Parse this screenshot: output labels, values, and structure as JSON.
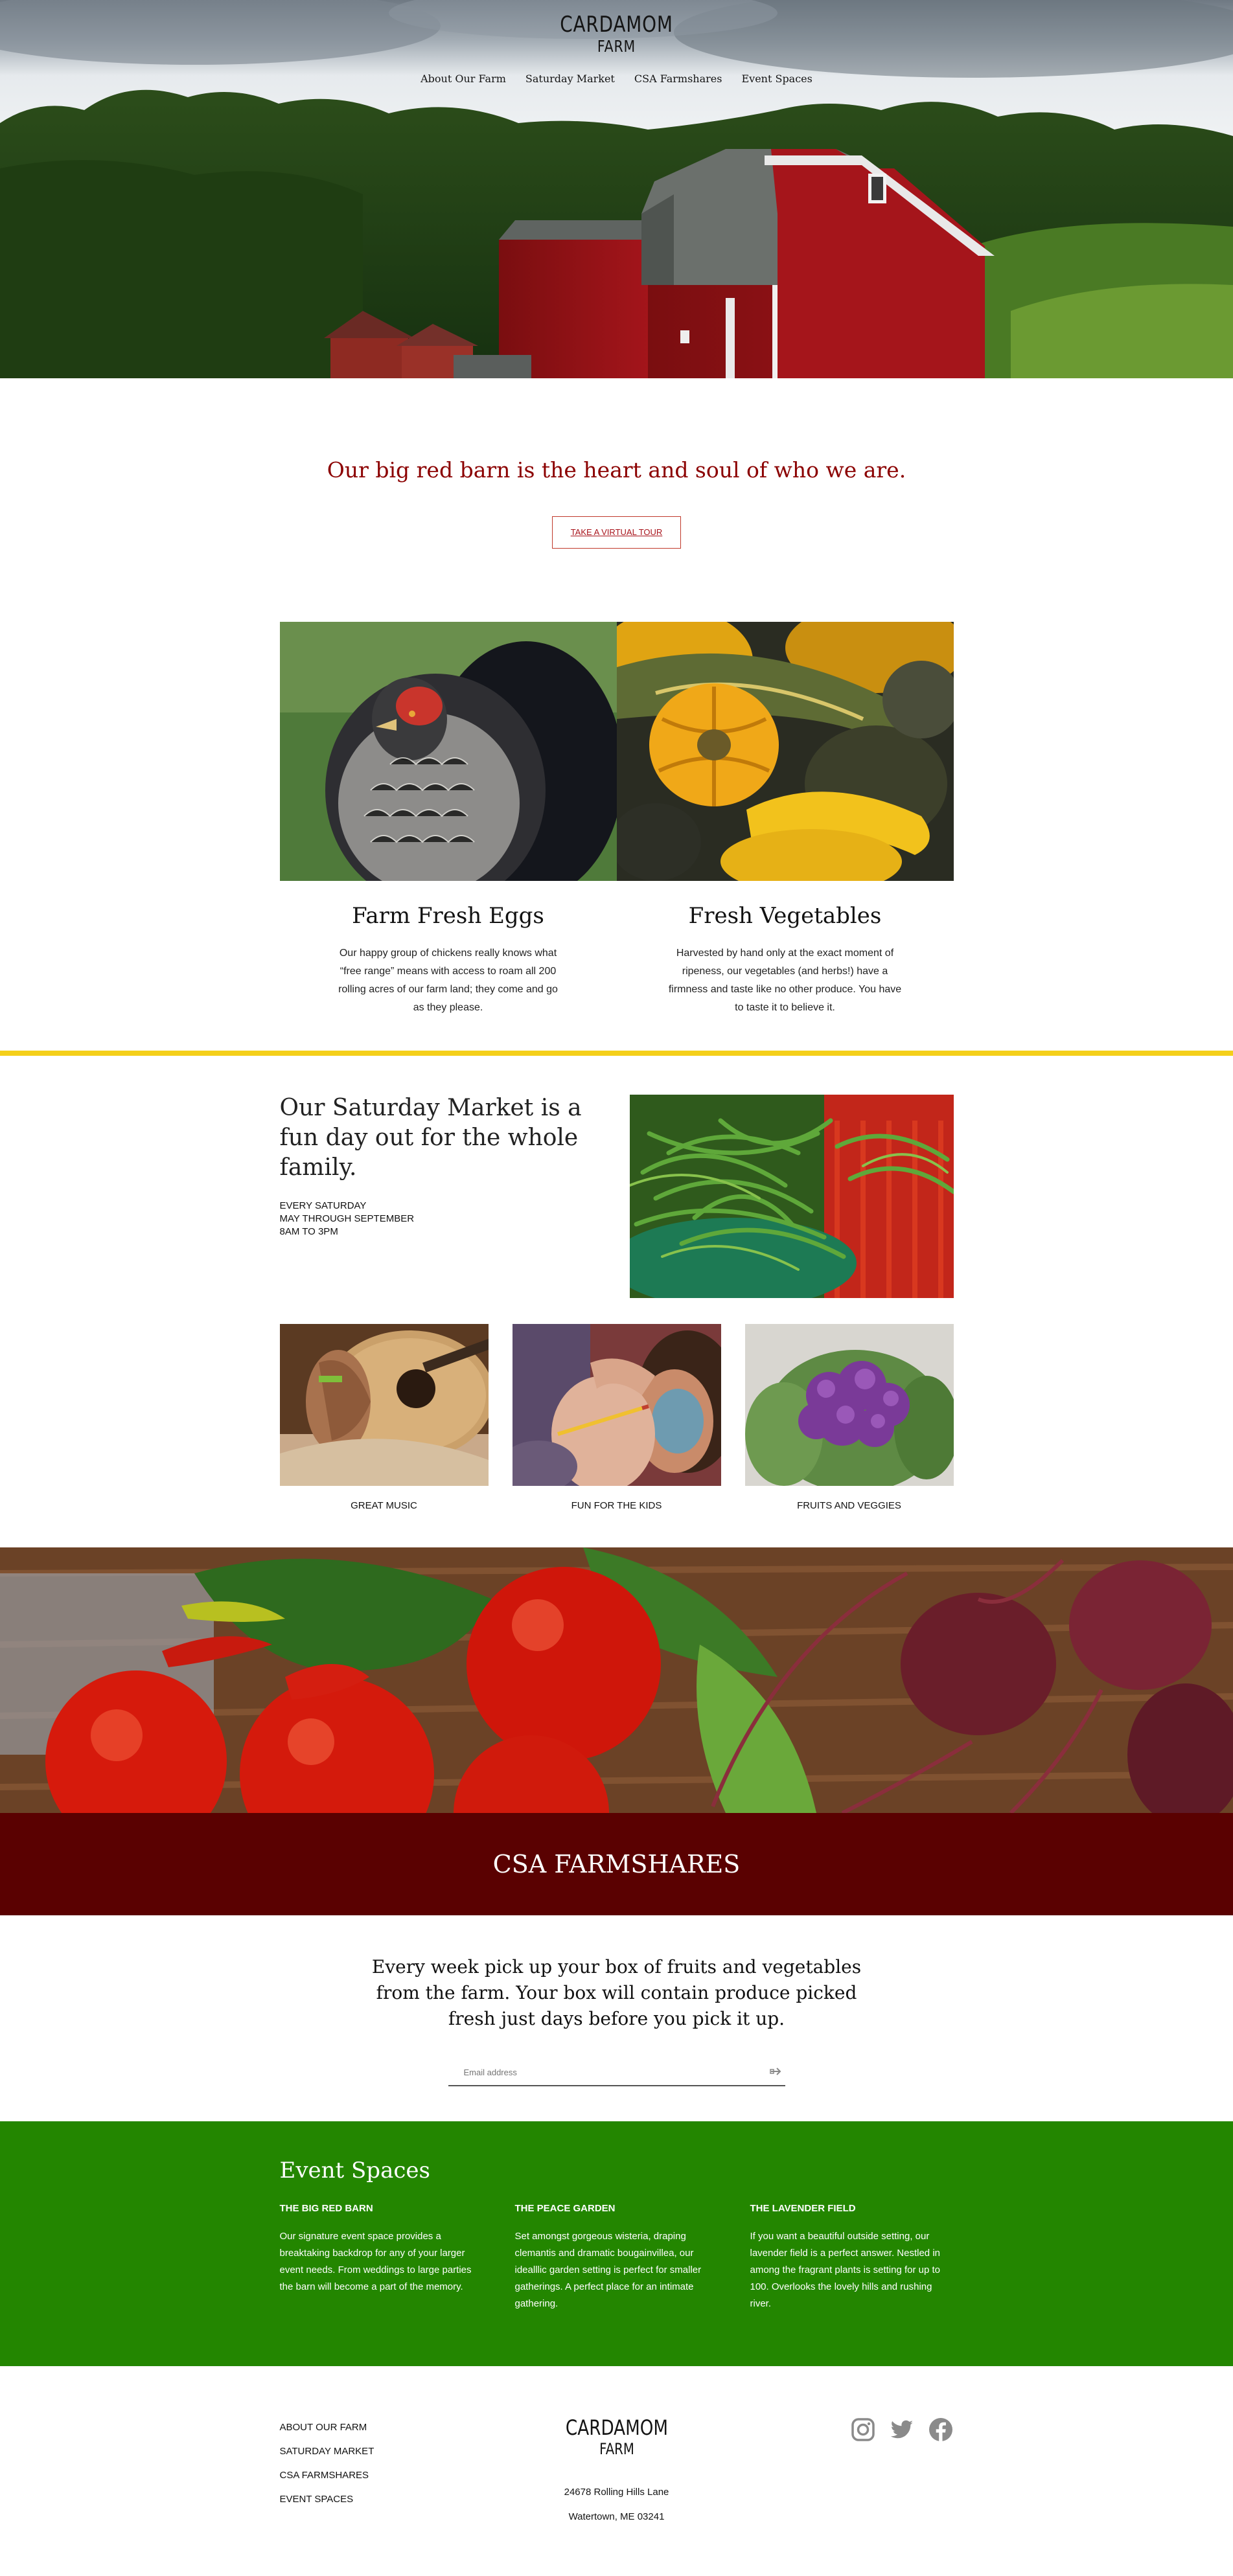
{
  "brand": {
    "line1": "CARDAMOM",
    "line2": "FARM"
  },
  "nav": [
    "About Our Farm",
    "Saturday Market",
    "CSA Farmshares",
    "Event Spaces"
  ],
  "intro": {
    "heading": "Our big red barn is the heart and soul of who we are.",
    "button": "TAKE A VIRTUAL TOUR"
  },
  "features": [
    {
      "title": "Farm Fresh Eggs",
      "text": "Our happy group of chickens really knows what “free range” means with access to roam all 200 rolling acres of our farm land; they come and go as they please."
    },
    {
      "title": "Fresh Vegetables",
      "text": "Harvested by hand only at the exact moment of ripeness, our vegetables (and herbs!) have a firmness and taste like no other produce. You have to taste it to believe it."
    }
  ],
  "market": {
    "heading": "Our Saturday Market is a fun day out for the whole family.",
    "schedule": [
      "EVERY SATURDAY",
      "MAY THROUGH SEPTEMBER",
      "8AM TO 3PM"
    ],
    "tiles": [
      "GREAT MUSIC",
      "FUN FOR THE KIDS",
      "FRUITS AND VEGGIES"
    ]
  },
  "csa": {
    "band": "CSA FARMSHARES",
    "text": "Every week pick up your box of fruits and vegetables from the farm. Your box will contain produce picked fresh just days before you pick it up.",
    "email_placeholder": "Email address"
  },
  "events": {
    "heading": "Event Spaces",
    "items": [
      {
        "title": "THE BIG RED BARN",
        "text": "Our signature event space provides a breaktaking backdrop for any of your larger event needs. From weddings to large parties the barn will become a part of the memory."
      },
      {
        "title": "THE PEACE GARDEN",
        "text": "Set amongst gorgeous wisteria, draping clemantis and dramatic bougainvillea, our idealllic garden setting is perfect for smaller gatherings. A perfect place for an intimate gathering."
      },
      {
        "title": "THE LAVENDER FIELD",
        "text": "If you want a beautiful outside setting, our lavender field is a perfect answer. Nestled in among the fragrant plants is setting for up to 100. Overlooks the lovely hills and rushing river."
      }
    ]
  },
  "footer": {
    "links": [
      "ABOUT OUR FARM",
      "SATURDAY MARKET",
      "CSA FARMSHARES",
      "EVENT SPACES"
    ],
    "address1": "24678 Rolling Hills Lane",
    "address2": "Watertown, ME 03241",
    "social": [
      "instagram-icon",
      "twitter-icon",
      "facebook-icon"
    ]
  },
  "colors": {
    "barn_red": "#8b0000",
    "accent_yellow": "#f4cf1a",
    "csa_maroon": "#5a0101",
    "events_green": "#238600"
  }
}
